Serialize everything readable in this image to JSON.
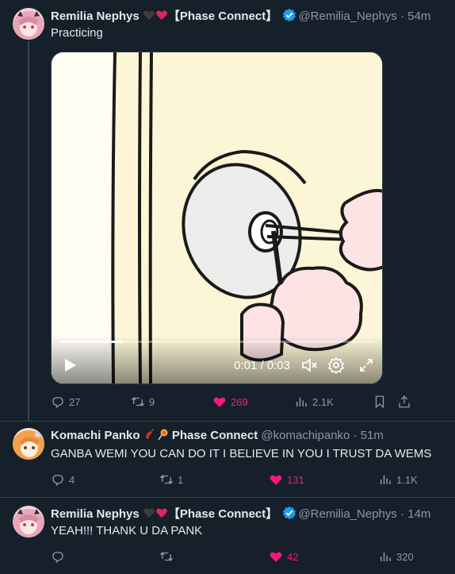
{
  "colors": {
    "background": "#15202b",
    "accent_blue": "#1d9bf0",
    "like_pink": "#f91880",
    "muted_text": "#8b98a5"
  },
  "tweets": [
    {
      "name": "Remilia Nephys",
      "emojis": [
        "black-heart",
        "red-heart"
      ],
      "name_suffix": "【Phase Connect】",
      "verified": true,
      "handle": "@Remilia_Nephys",
      "separator": "·",
      "time": "54m",
      "text": "Practicing",
      "video": {
        "progress_fraction": 0.2,
        "time_readout": "0:01 / 0:03",
        "icons": [
          "play-icon",
          "mute-icon",
          "settings-gear-icon",
          "fullscreen-icon"
        ]
      },
      "actions": {
        "replies": "27",
        "retweets": "9",
        "likes": "269",
        "liked": true,
        "views": "2.1K"
      }
    },
    {
      "name": "Komachi Panko",
      "emojis": [
        "chili-pepper",
        "lollipop"
      ],
      "name_suffix": "Phase Connect",
      "verified": false,
      "handle": "@komachipanko",
      "separator": "·",
      "time": "51m",
      "text": "GANBA WEMI YOU CAN DO IT I BELIEVE IN YOU I TRUST DA WEMS",
      "actions": {
        "replies": "4",
        "retweets": "1",
        "likes": "131",
        "liked": true,
        "views": "1.1K"
      }
    },
    {
      "name": "Remilia Nephys",
      "emojis": [
        "black-heart",
        "red-heart"
      ],
      "name_suffix": "【Phase Connect】",
      "verified": true,
      "handle": "@Remilia_Nephys",
      "separator": "·",
      "time": "14m",
      "text": "YEAH!!! THANK U DA PANK",
      "actions": {
        "replies": "",
        "retweets": "",
        "likes": "42",
        "liked": true,
        "views": "320"
      }
    }
  ]
}
